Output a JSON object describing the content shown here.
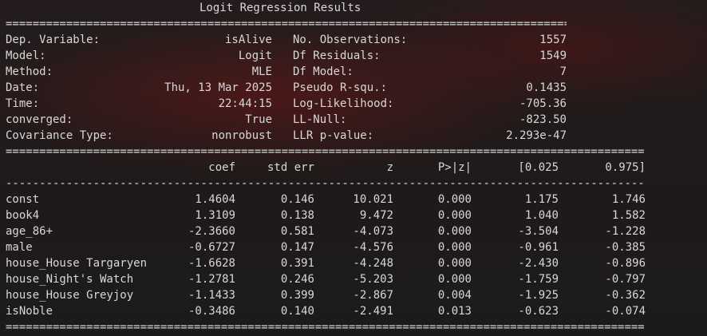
{
  "title": "Logit Regression Results",
  "rules": {
    "double": "===========================================================================================================",
    "single": "-----------------------------------------------------------------------------------------------------------"
  },
  "header": {
    "left": [
      {
        "label": "Dep. Variable:",
        "value": "isAlive"
      },
      {
        "label": "Model:",
        "value": "Logit"
      },
      {
        "label": "Method:",
        "value": "MLE"
      },
      {
        "label": "Date:",
        "value": "Thu, 13 Mar 2025"
      },
      {
        "label": "Time:",
        "value": "22:44:15"
      },
      {
        "label": "converged:",
        "value": "True"
      },
      {
        "label": "Covariance Type:",
        "value": "nonrobust"
      }
    ],
    "right": [
      {
        "label": "No. Observations:",
        "value": "1557"
      },
      {
        "label": "Df Residuals:",
        "value": "1549"
      },
      {
        "label": "Df Model:",
        "value": "7"
      },
      {
        "label": "Pseudo R-squ.:",
        "value": "0.1435"
      },
      {
        "label": "Log-Likelihood:",
        "value": "-705.36"
      },
      {
        "label": "LL-Null:",
        "value": "-823.50"
      },
      {
        "label": "LLR p-value:",
        "value": "2.293e-47"
      }
    ]
  },
  "columns": [
    "coef",
    "std err",
    "z",
    "P>|z|",
    "[0.025",
    "0.975]"
  ],
  "rows": [
    {
      "name": "const",
      "coef": "1.4604",
      "std_err": "0.146",
      "z": "10.021",
      "p": "0.000",
      "lo": "1.175",
      "hi": "1.746"
    },
    {
      "name": "book4",
      "coef": "1.3109",
      "std_err": "0.138",
      "z": "9.472",
      "p": "0.000",
      "lo": "1.040",
      "hi": "1.582"
    },
    {
      "name": "age_86+",
      "coef": "-2.3660",
      "std_err": "0.581",
      "z": "-4.073",
      "p": "0.000",
      "lo": "-3.504",
      "hi": "-1.228"
    },
    {
      "name": "male",
      "coef": "-0.6727",
      "std_err": "0.147",
      "z": "-4.576",
      "p": "0.000",
      "lo": "-0.961",
      "hi": "-0.385"
    },
    {
      "name": "house_House Targaryen",
      "coef": "-1.6628",
      "std_err": "0.391",
      "z": "-4.248",
      "p": "0.000",
      "lo": "-2.430",
      "hi": "-0.896"
    },
    {
      "name": "house_Night's Watch",
      "coef": "-1.2781",
      "std_err": "0.246",
      "z": "-5.203",
      "p": "0.000",
      "lo": "-1.759",
      "hi": "-0.797"
    },
    {
      "name": "house_House Greyjoy",
      "coef": "-1.1433",
      "std_err": "0.399",
      "z": "-2.867",
      "p": "0.004",
      "lo": "-1.925",
      "hi": "-0.362"
    },
    {
      "name": "isNoble",
      "coef": "-0.3486",
      "std_err": "0.140",
      "z": "-2.491",
      "p": "0.013",
      "lo": "-0.623",
      "hi": "-0.074"
    }
  ]
}
